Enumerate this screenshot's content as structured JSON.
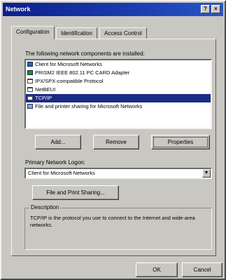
{
  "window": {
    "title": "Network",
    "help_glyph": "?",
    "close_glyph": "×"
  },
  "tabs": [
    {
      "label": "Configuration",
      "active": true
    },
    {
      "label": "Identification",
      "active": false
    },
    {
      "label": "Access Control",
      "active": false
    }
  ],
  "components": {
    "heading": "The following network components are installed:",
    "items": [
      {
        "label": "Client for Microsoft Networks",
        "icon": "client-icon",
        "selected": false
      },
      {
        "label": "PRISM2 IEEE 802.11 PC CARD Adapter",
        "icon": "network-adapter-icon",
        "selected": false
      },
      {
        "label": "IPX/SPX-compatible Protocol",
        "icon": "protocol-icon",
        "selected": false
      },
      {
        "label": "NetBEUI",
        "icon": "protocol-icon",
        "selected": false
      },
      {
        "label": "TCP/IP",
        "icon": "protocol-icon",
        "selected": true
      },
      {
        "label": "File and printer sharing for Microsoft Networks",
        "icon": "sharing-icon",
        "selected": false
      }
    ]
  },
  "buttons": {
    "add": "Add...",
    "remove": "Remove",
    "properties": "Properties",
    "file_print_sharing": "File and Print Sharing...",
    "ok": "OK",
    "cancel": "Cancel"
  },
  "logon": {
    "label": "Primary Network Logon:",
    "value": "Client for Microsoft Networks"
  },
  "description": {
    "legend": "Description",
    "text": "TCP/IP is the protocol you use to connect to the Internet and wide-area networks."
  }
}
